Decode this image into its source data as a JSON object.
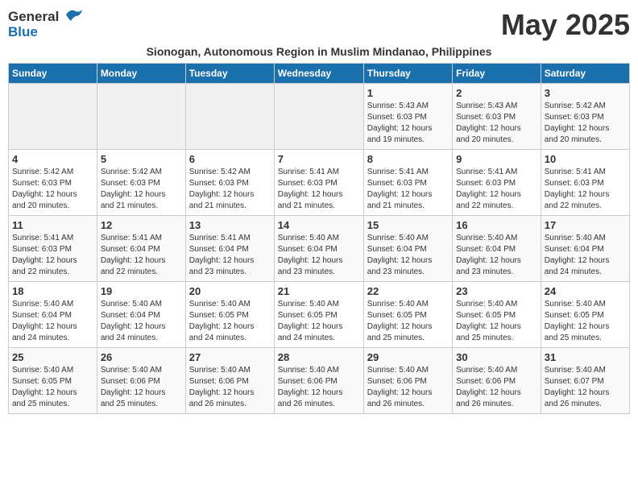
{
  "logo": {
    "general": "General",
    "blue": "Blue"
  },
  "title": {
    "month_year": "May 2025",
    "subtitle": "Sionogan, Autonomous Region in Muslim Mindanao, Philippines"
  },
  "weekdays": [
    "Sunday",
    "Monday",
    "Tuesday",
    "Wednesday",
    "Thursday",
    "Friday",
    "Saturday"
  ],
  "weeks": [
    [
      {
        "day": "",
        "info": ""
      },
      {
        "day": "",
        "info": ""
      },
      {
        "day": "",
        "info": ""
      },
      {
        "day": "",
        "info": ""
      },
      {
        "day": "1",
        "info": "Sunrise: 5:43 AM\nSunset: 6:03 PM\nDaylight: 12 hours\nand 19 minutes."
      },
      {
        "day": "2",
        "info": "Sunrise: 5:43 AM\nSunset: 6:03 PM\nDaylight: 12 hours\nand 20 minutes."
      },
      {
        "day": "3",
        "info": "Sunrise: 5:42 AM\nSunset: 6:03 PM\nDaylight: 12 hours\nand 20 minutes."
      }
    ],
    [
      {
        "day": "4",
        "info": "Sunrise: 5:42 AM\nSunset: 6:03 PM\nDaylight: 12 hours\nand 20 minutes."
      },
      {
        "day": "5",
        "info": "Sunrise: 5:42 AM\nSunset: 6:03 PM\nDaylight: 12 hours\nand 21 minutes."
      },
      {
        "day": "6",
        "info": "Sunrise: 5:42 AM\nSunset: 6:03 PM\nDaylight: 12 hours\nand 21 minutes."
      },
      {
        "day": "7",
        "info": "Sunrise: 5:41 AM\nSunset: 6:03 PM\nDaylight: 12 hours\nand 21 minutes."
      },
      {
        "day": "8",
        "info": "Sunrise: 5:41 AM\nSunset: 6:03 PM\nDaylight: 12 hours\nand 21 minutes."
      },
      {
        "day": "9",
        "info": "Sunrise: 5:41 AM\nSunset: 6:03 PM\nDaylight: 12 hours\nand 22 minutes."
      },
      {
        "day": "10",
        "info": "Sunrise: 5:41 AM\nSunset: 6:03 PM\nDaylight: 12 hours\nand 22 minutes."
      }
    ],
    [
      {
        "day": "11",
        "info": "Sunrise: 5:41 AM\nSunset: 6:03 PM\nDaylight: 12 hours\nand 22 minutes."
      },
      {
        "day": "12",
        "info": "Sunrise: 5:41 AM\nSunset: 6:04 PM\nDaylight: 12 hours\nand 22 minutes."
      },
      {
        "day": "13",
        "info": "Sunrise: 5:41 AM\nSunset: 6:04 PM\nDaylight: 12 hours\nand 23 minutes."
      },
      {
        "day": "14",
        "info": "Sunrise: 5:40 AM\nSunset: 6:04 PM\nDaylight: 12 hours\nand 23 minutes."
      },
      {
        "day": "15",
        "info": "Sunrise: 5:40 AM\nSunset: 6:04 PM\nDaylight: 12 hours\nand 23 minutes."
      },
      {
        "day": "16",
        "info": "Sunrise: 5:40 AM\nSunset: 6:04 PM\nDaylight: 12 hours\nand 23 minutes."
      },
      {
        "day": "17",
        "info": "Sunrise: 5:40 AM\nSunset: 6:04 PM\nDaylight: 12 hours\nand 24 minutes."
      }
    ],
    [
      {
        "day": "18",
        "info": "Sunrise: 5:40 AM\nSunset: 6:04 PM\nDaylight: 12 hours\nand 24 minutes."
      },
      {
        "day": "19",
        "info": "Sunrise: 5:40 AM\nSunset: 6:04 PM\nDaylight: 12 hours\nand 24 minutes."
      },
      {
        "day": "20",
        "info": "Sunrise: 5:40 AM\nSunset: 6:05 PM\nDaylight: 12 hours\nand 24 minutes."
      },
      {
        "day": "21",
        "info": "Sunrise: 5:40 AM\nSunset: 6:05 PM\nDaylight: 12 hours\nand 24 minutes."
      },
      {
        "day": "22",
        "info": "Sunrise: 5:40 AM\nSunset: 6:05 PM\nDaylight: 12 hours\nand 25 minutes."
      },
      {
        "day": "23",
        "info": "Sunrise: 5:40 AM\nSunset: 6:05 PM\nDaylight: 12 hours\nand 25 minutes."
      },
      {
        "day": "24",
        "info": "Sunrise: 5:40 AM\nSunset: 6:05 PM\nDaylight: 12 hours\nand 25 minutes."
      }
    ],
    [
      {
        "day": "25",
        "info": "Sunrise: 5:40 AM\nSunset: 6:05 PM\nDaylight: 12 hours\nand 25 minutes."
      },
      {
        "day": "26",
        "info": "Sunrise: 5:40 AM\nSunset: 6:06 PM\nDaylight: 12 hours\nand 25 minutes."
      },
      {
        "day": "27",
        "info": "Sunrise: 5:40 AM\nSunset: 6:06 PM\nDaylight: 12 hours\nand 26 minutes."
      },
      {
        "day": "28",
        "info": "Sunrise: 5:40 AM\nSunset: 6:06 PM\nDaylight: 12 hours\nand 26 minutes."
      },
      {
        "day": "29",
        "info": "Sunrise: 5:40 AM\nSunset: 6:06 PM\nDaylight: 12 hours\nand 26 minutes."
      },
      {
        "day": "30",
        "info": "Sunrise: 5:40 AM\nSunset: 6:06 PM\nDaylight: 12 hours\nand 26 minutes."
      },
      {
        "day": "31",
        "info": "Sunrise: 5:40 AM\nSunset: 6:07 PM\nDaylight: 12 hours\nand 26 minutes."
      }
    ]
  ]
}
